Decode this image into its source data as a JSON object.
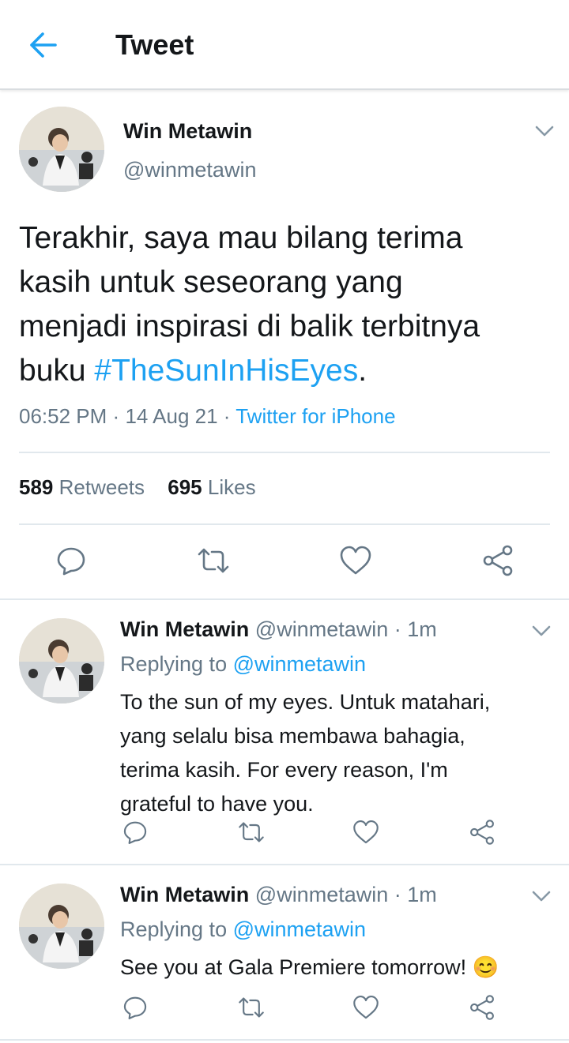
{
  "header": {
    "title": "Tweet"
  },
  "main_tweet": {
    "author": {
      "name": "Win Metawin",
      "handle": "@winmetawin"
    },
    "text": {
      "line1": "Terakhir, saya mau bilang terima",
      "line2": "kasih untuk seseorang yang",
      "line3": "menjadi inspirasi di balik terbitnya",
      "line4_prefix": "buku ",
      "hashtag": "#TheSunInHisEyes",
      "line4_suffix": "."
    },
    "time": "06:52 PM",
    "date": "14 Aug 21",
    "sep": "·",
    "source": "Twitter for iPhone",
    "stats": {
      "retweets_count": "589",
      "retweets_label": "Retweets",
      "likes_count": "695",
      "likes_label": "Likes"
    }
  },
  "replies": [
    {
      "name": "Win Metawin",
      "handle": "@winmetawin",
      "time": "· 1m",
      "replying_label": "Replying to",
      "replying_handle": "@winmetawin",
      "lines": [
        "To the sun of my eyes. Untuk matahari,",
        "yang selalu bisa membawa bahagia,",
        "terima kasih. For every reason, I'm",
        "grateful to have you."
      ]
    },
    {
      "name": "Win Metawin",
      "handle": "@winmetawin",
      "time": "· 1m",
      "replying_label": "Replying to",
      "replying_handle": "@winmetawin",
      "lines": [
        "See you at Gala Premiere tomorrow! 😊"
      ]
    }
  ],
  "icons": {
    "back": "arrow-left-icon",
    "reply": "reply-icon",
    "retweet": "retweet-icon",
    "like": "heart-icon",
    "share": "share-icon",
    "more": "chevron-down-icon"
  },
  "colors": {
    "accent": "#1da1f2",
    "muted": "#657786",
    "divider": "#e1e8ed"
  }
}
